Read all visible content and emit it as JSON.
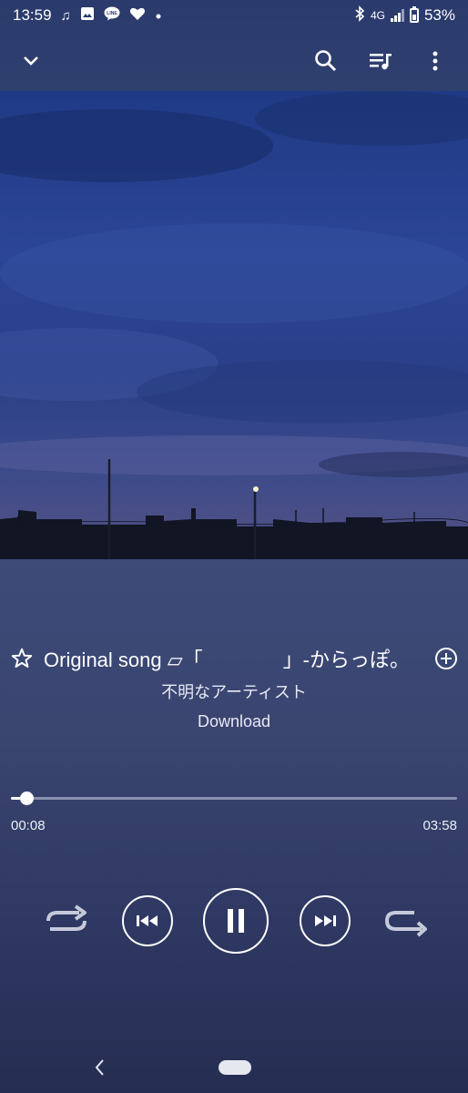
{
  "status_bar": {
    "time": "13:59",
    "network": "4G",
    "battery": "53%",
    "battery_level": 0.53,
    "notification_icons": [
      "music-note-icon",
      "image-icon",
      "line-app-icon",
      "heart-icon",
      "dot-icon"
    ]
  },
  "top_bar": {
    "collapse_icon": "chevron-down-icon",
    "search_icon": "search-icon",
    "queue_icon": "playlist-icon",
    "menu_icon": "more-vert-icon"
  },
  "track": {
    "title": "Original song ▱「　　　　」-からっぽ。",
    "artist": "不明なアーティスト",
    "album": "Download"
  },
  "playback": {
    "elapsed": "00:08",
    "duration": "03:58",
    "progress_fraction": 0.034
  },
  "colors": {
    "accent": "#ffffff",
    "background_top": "#2a3a6c",
    "background_bottom": "#252d52"
  }
}
